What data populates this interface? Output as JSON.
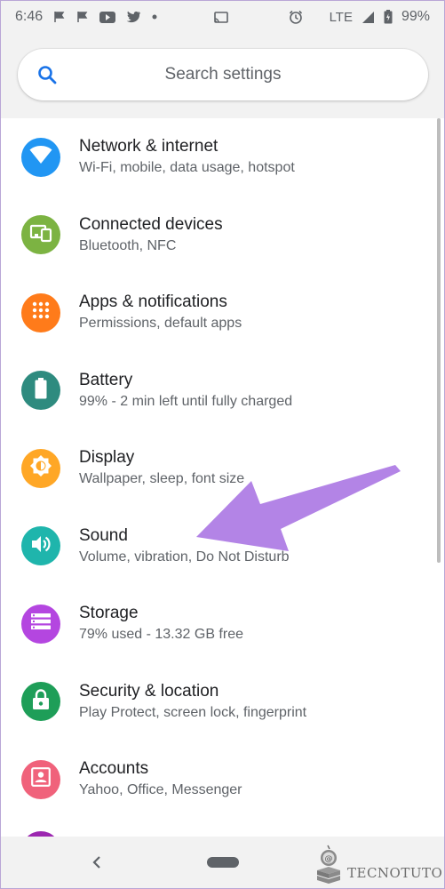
{
  "status_bar": {
    "time": "6:46",
    "network": "LTE",
    "battery": "99%"
  },
  "search": {
    "placeholder": "Search settings"
  },
  "items": [
    {
      "title": "Network & internet",
      "subtitle": "Wi-Fi, mobile, data usage, hotspot",
      "color": "#2196f3",
      "icon": "wifi-icon"
    },
    {
      "title": "Connected devices",
      "subtitle": "Bluetooth, NFC",
      "color": "#7cb342",
      "icon": "connected-devices-icon"
    },
    {
      "title": "Apps & notifications",
      "subtitle": "Permissions, default apps",
      "color": "#ff7b1a",
      "icon": "apps-grid-icon"
    },
    {
      "title": "Battery",
      "subtitle": "99% - 2 min left until fully charged",
      "color": "#2e8b7f",
      "icon": "battery-icon"
    },
    {
      "title": "Display",
      "subtitle": "Wallpaper, sleep, font size",
      "color": "#ffa726",
      "icon": "brightness-icon"
    },
    {
      "title": "Sound",
      "subtitle": "Volume, vibration, Do Not Disturb",
      "color": "#1fb5ac",
      "icon": "volume-icon"
    },
    {
      "title": "Storage",
      "subtitle": "79% used - 13.32 GB free",
      "color": "#b446e0",
      "icon": "storage-icon"
    },
    {
      "title": "Security & location",
      "subtitle": "Play Protect, screen lock, fingerprint",
      "color": "#1e9e58",
      "icon": "lock-icon"
    },
    {
      "title": "Accounts",
      "subtitle": "Yahoo, Office, Messenger",
      "color": "#f0627b",
      "icon": "account-icon"
    }
  ],
  "partial_item_color": "#9c27b0",
  "annotation": {
    "arrow_color": "#b384e6"
  },
  "watermark": {
    "text": "TECNOTUTO"
  }
}
